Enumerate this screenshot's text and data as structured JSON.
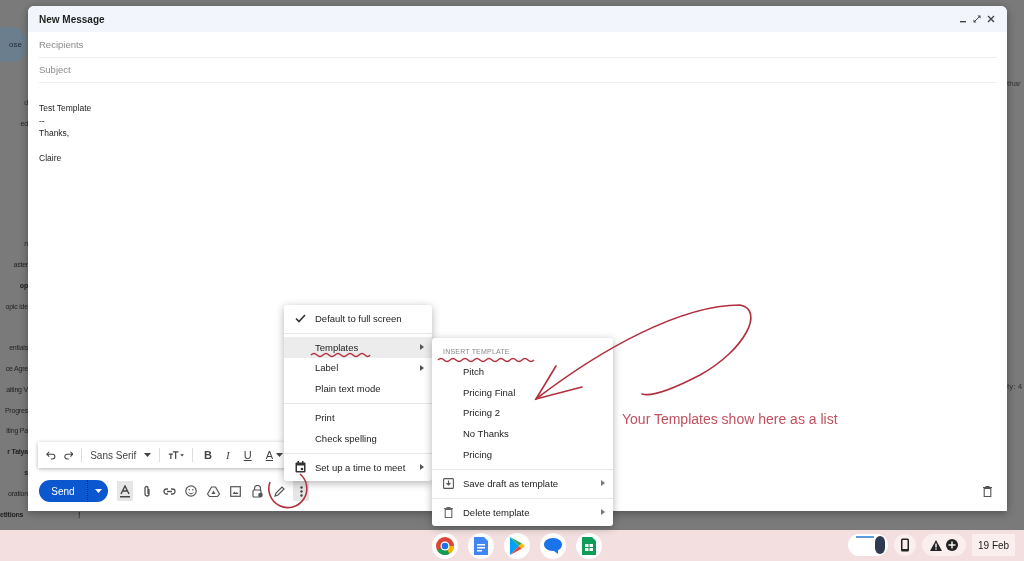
{
  "background_mail": {
    "sidebar_groups": [
      {
        "kind": "compose",
        "items": [
          {
            "label": "ose",
            "unread": false
          }
        ]
      },
      {
        "kind": "list",
        "items": [
          {
            "label": "d",
            "unread": false
          },
          {
            "label": "ed",
            "unread": false
          }
        ]
      },
      {
        "kind": "list",
        "items": [
          {
            "label": "n",
            "unread": false
          },
          {
            "label": "aster",
            "unread": false
          },
          {
            "label": "op",
            "unread": true
          },
          {
            "label": "opic ide",
            "unread": false
          }
        ]
      },
      {
        "kind": "list",
        "items": [
          {
            "label": "entials",
            "unread": false
          },
          {
            "label": "ce Agre",
            "unread": false
          },
          {
            "label": "aiting V",
            "unread": false
          },
          {
            "label": "Progres",
            "unread": false
          },
          {
            "label": "iting Pa",
            "unread": false
          },
          {
            "label": "r Talya",
            "unread": true
          },
          {
            "label": "s",
            "unread": true
          },
          {
            "label": "oration",
            "unread": false
          }
        ]
      },
      {
        "kind": "list",
        "items": [
          {
            "label": "etitions",
            "unread": true,
            "count": "!"
          }
        ]
      }
    ],
    "right_edge_texts": [
      "thar",
      "ty: 4"
    ]
  },
  "compose": {
    "title": "New Message",
    "recipients": {
      "placeholder": "Recipients"
    },
    "subject": {
      "placeholder": "Subject"
    },
    "body": [
      [
        "Test Template",
        "--",
        "Thanks,"
      ],
      [
        "Claire"
      ]
    ],
    "format_toolbar": {
      "font": "Sans Serif",
      "buttons": [
        {
          "kind": "bold",
          "glyph": "B"
        },
        {
          "kind": "italic",
          "glyph": "I"
        },
        {
          "kind": "underline",
          "glyph": "U"
        },
        {
          "kind": "color",
          "glyph": "A"
        }
      ]
    },
    "send": "Send"
  },
  "more_menu": {
    "sections": [
      {
        "items": [
          {
            "kind": "option",
            "label": "Default to full screen",
            "checked": true,
            "selected": false,
            "submenu": false
          }
        ]
      },
      {
        "items": [
          {
            "kind": "option",
            "label": "Templates",
            "checked": false,
            "selected": true,
            "submenu": true
          },
          {
            "kind": "option",
            "label": "Label",
            "checked": false,
            "selected": false,
            "submenu": true
          },
          {
            "kind": "option",
            "label": "Plain text mode",
            "checked": false,
            "selected": false,
            "submenu": false
          }
        ]
      },
      {
        "items": [
          {
            "kind": "option",
            "label": "Print",
            "checked": false,
            "selected": false,
            "submenu": false
          },
          {
            "kind": "option",
            "label": "Check spelling",
            "checked": false,
            "selected": false,
            "submenu": false
          }
        ]
      },
      {
        "items": [
          {
            "kind": "schedule",
            "label": "Set up a time to meet",
            "checked": false,
            "selected": false,
            "submenu": true
          }
        ]
      }
    ]
  },
  "templates_menu": {
    "header": "INSERT TEMPLATE",
    "templates": [
      {
        "label": "Pitch",
        "selected": false
      },
      {
        "label": "Pricing Final",
        "selected": false
      },
      {
        "label": "Pricing 2",
        "selected": false
      },
      {
        "label": "No Thanks",
        "selected": false
      },
      {
        "label": "Pricing",
        "selected": false
      }
    ],
    "actions": [
      {
        "kind": "save",
        "label": "Save draft as template",
        "submenu": true
      },
      {
        "kind": "delete",
        "label": "Delete template",
        "submenu": true
      }
    ]
  },
  "annotation": {
    "text": "Your Templates show here as a list"
  },
  "shelf": {
    "date": "19 Feb"
  }
}
